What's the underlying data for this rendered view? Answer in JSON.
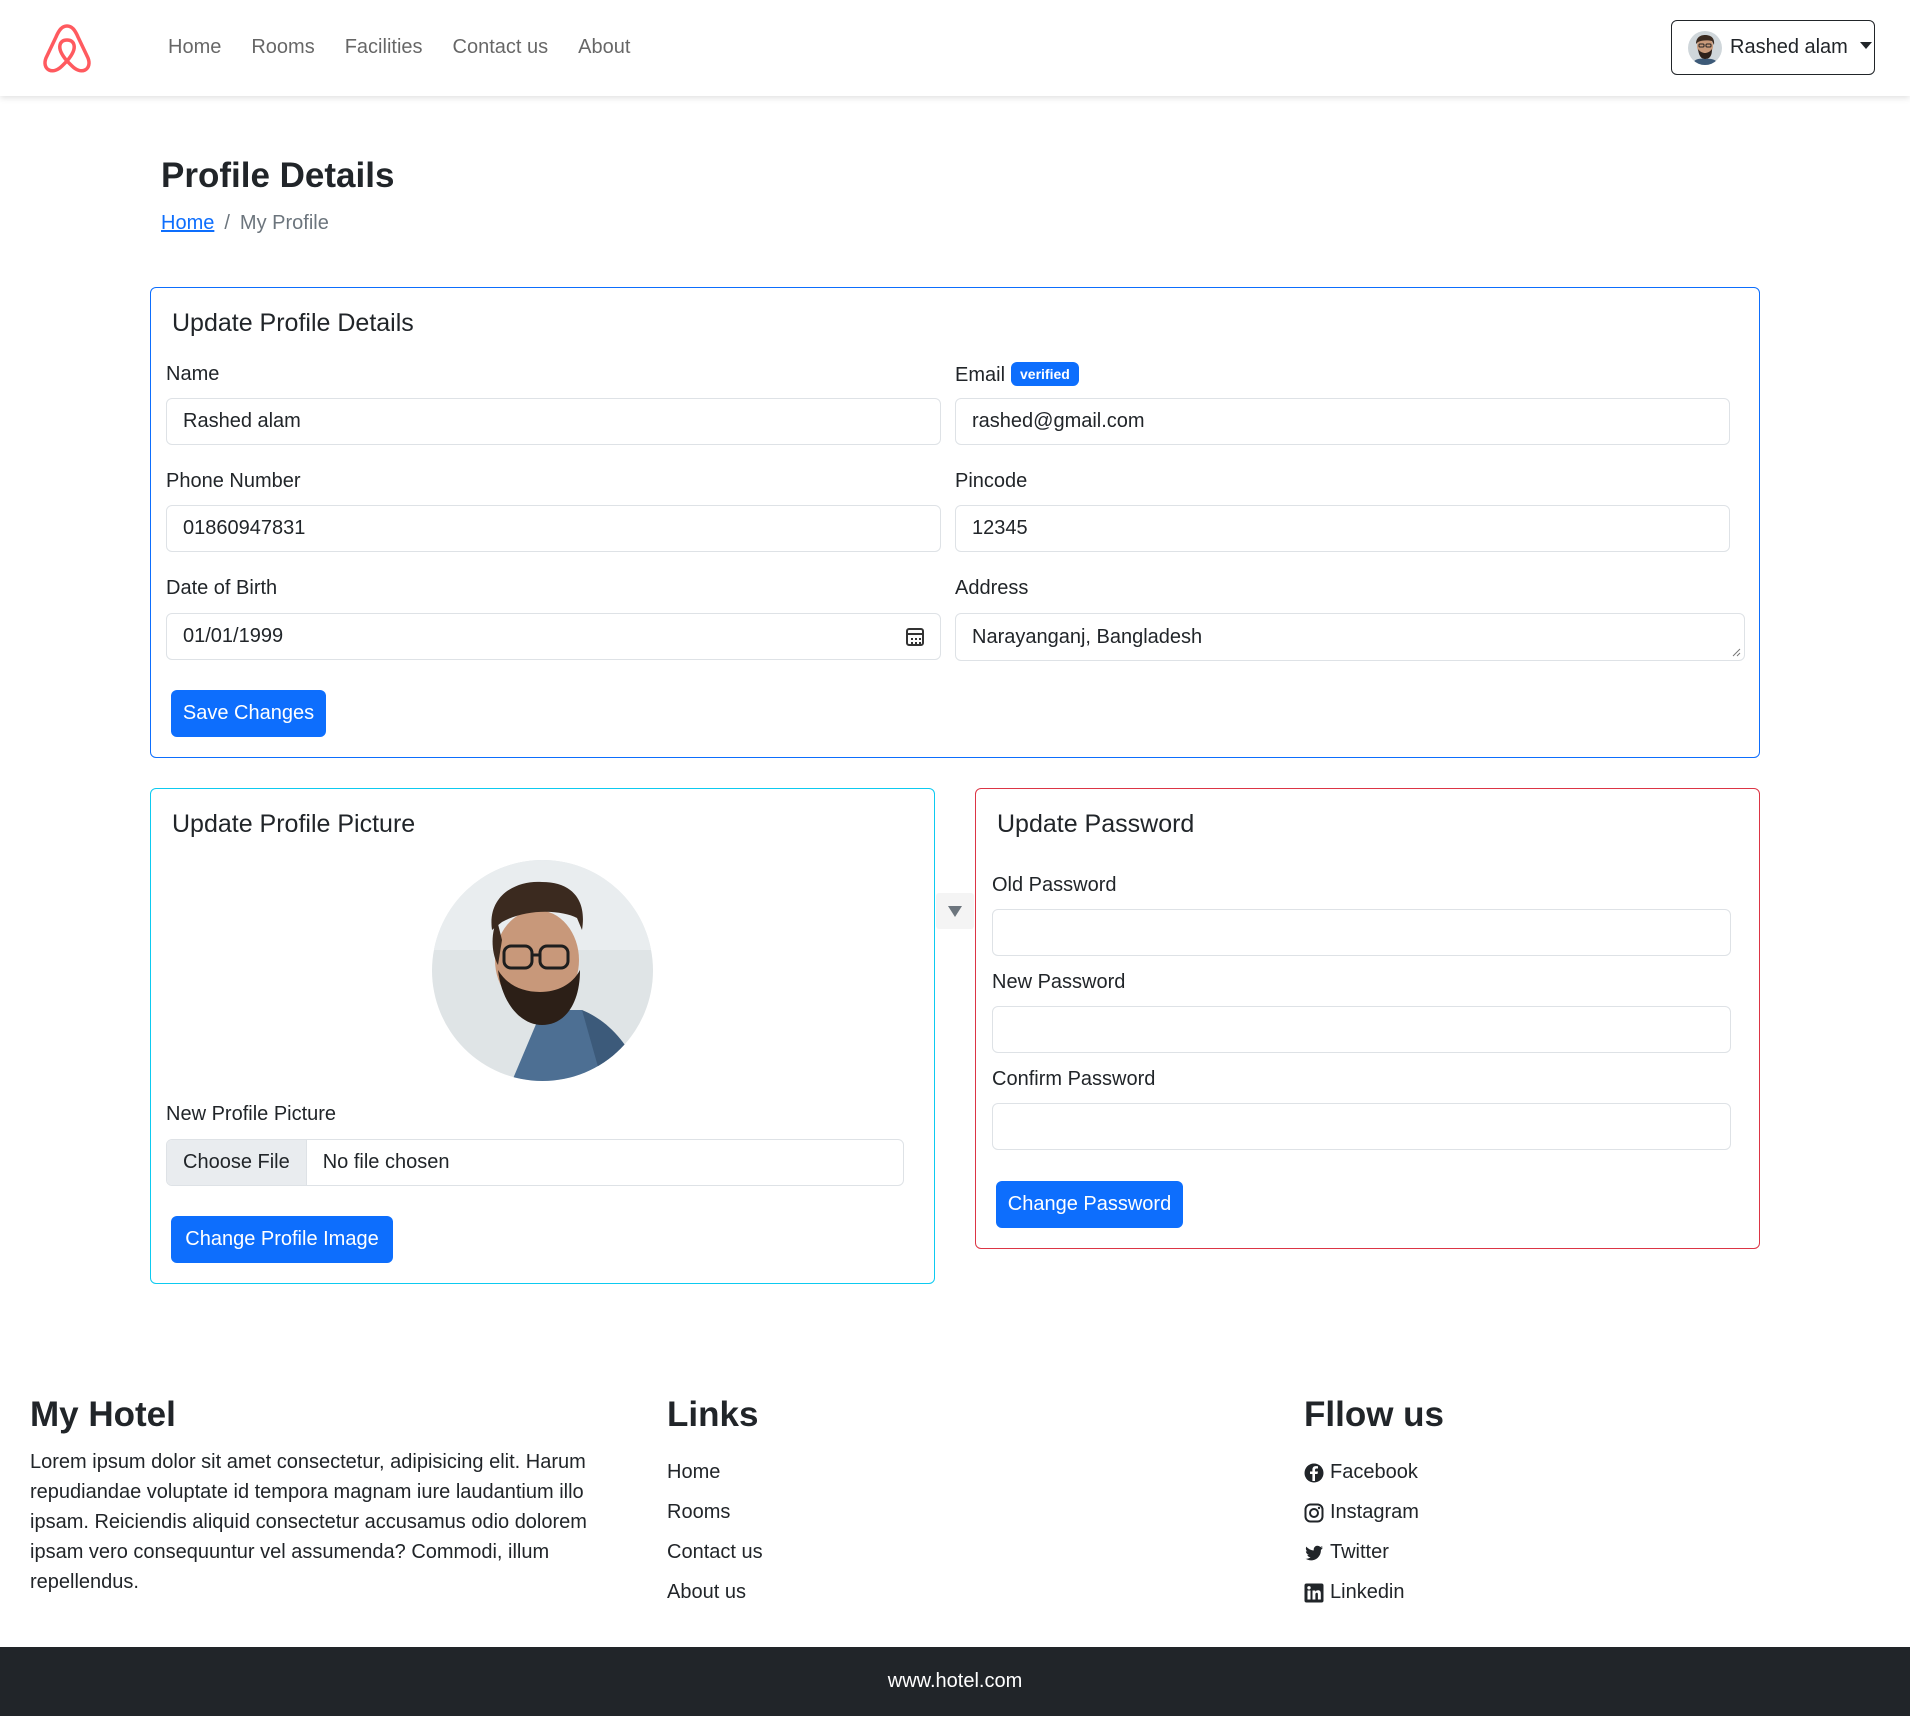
{
  "navbar": {
    "links": [
      "Home",
      "Rooms",
      "Facilities",
      "Contact us",
      "About"
    ],
    "user_name": "Rashed alam",
    "brand_icon": "airbnb-logo",
    "brand_color": "#ff5a5f"
  },
  "header": {
    "title": "Profile Details",
    "breadcrumb_home": "Home",
    "breadcrumb_sep": "/",
    "breadcrumb_current": "My Profile"
  },
  "profile_form": {
    "title": "Update Profile Details",
    "name_label": "Name",
    "name_value": "Rashed alam",
    "email_label": "Email",
    "email_badge": "verified",
    "email_value": "rashed@gmail.com",
    "phone_label": "Phone Number",
    "phone_value": "01860947831",
    "pincode_label": "Pincode",
    "pincode_value": "12345",
    "dob_label": "Date of Birth",
    "dob_value": "01/01/1999",
    "address_label": "Address",
    "address_value": "Narayanganj, Bangladesh",
    "save_label": "Save Changes"
  },
  "picture_form": {
    "title": "Update Profile Picture",
    "new_picture_label": "New Profile Picture",
    "choose_file_label": "Choose File",
    "file_status": "No file chosen",
    "submit_label": "Change Profile Image"
  },
  "password_form": {
    "title": "Update Password",
    "old_label": "Old Password",
    "new_label": "New Password",
    "confirm_label": "Confirm Password",
    "submit_label": "Change Password"
  },
  "footer": {
    "hotel_title": "My Hotel",
    "hotel_text": "Lorem ipsum dolor sit amet consectetur, adipisicing elit. Harum repudiandae voluptate id tempora magnam iure laudantium illo ipsam. Reiciendis aliquid consectetur accusamus odio dolorem ipsam vero consequuntur vel assumenda? Commodi, illum repellendus.",
    "links_title": "Links",
    "links": [
      "Home",
      "Rooms",
      "Contact us",
      "About us"
    ],
    "follow_title": "Fllow us",
    "social": [
      {
        "label": "Facebook",
        "icon": "facebook-icon"
      },
      {
        "label": "Instagram",
        "icon": "instagram-icon"
      },
      {
        "label": "Twitter",
        "icon": "twitter-icon"
      },
      {
        "label": "Linkedin",
        "icon": "linkedin-icon"
      }
    ],
    "bottom_text": "www.hotel.com"
  },
  "colors": {
    "primary": "#0d6efd",
    "info": "#0dcaf0",
    "danger": "#dc3545",
    "dark": "#212529"
  }
}
